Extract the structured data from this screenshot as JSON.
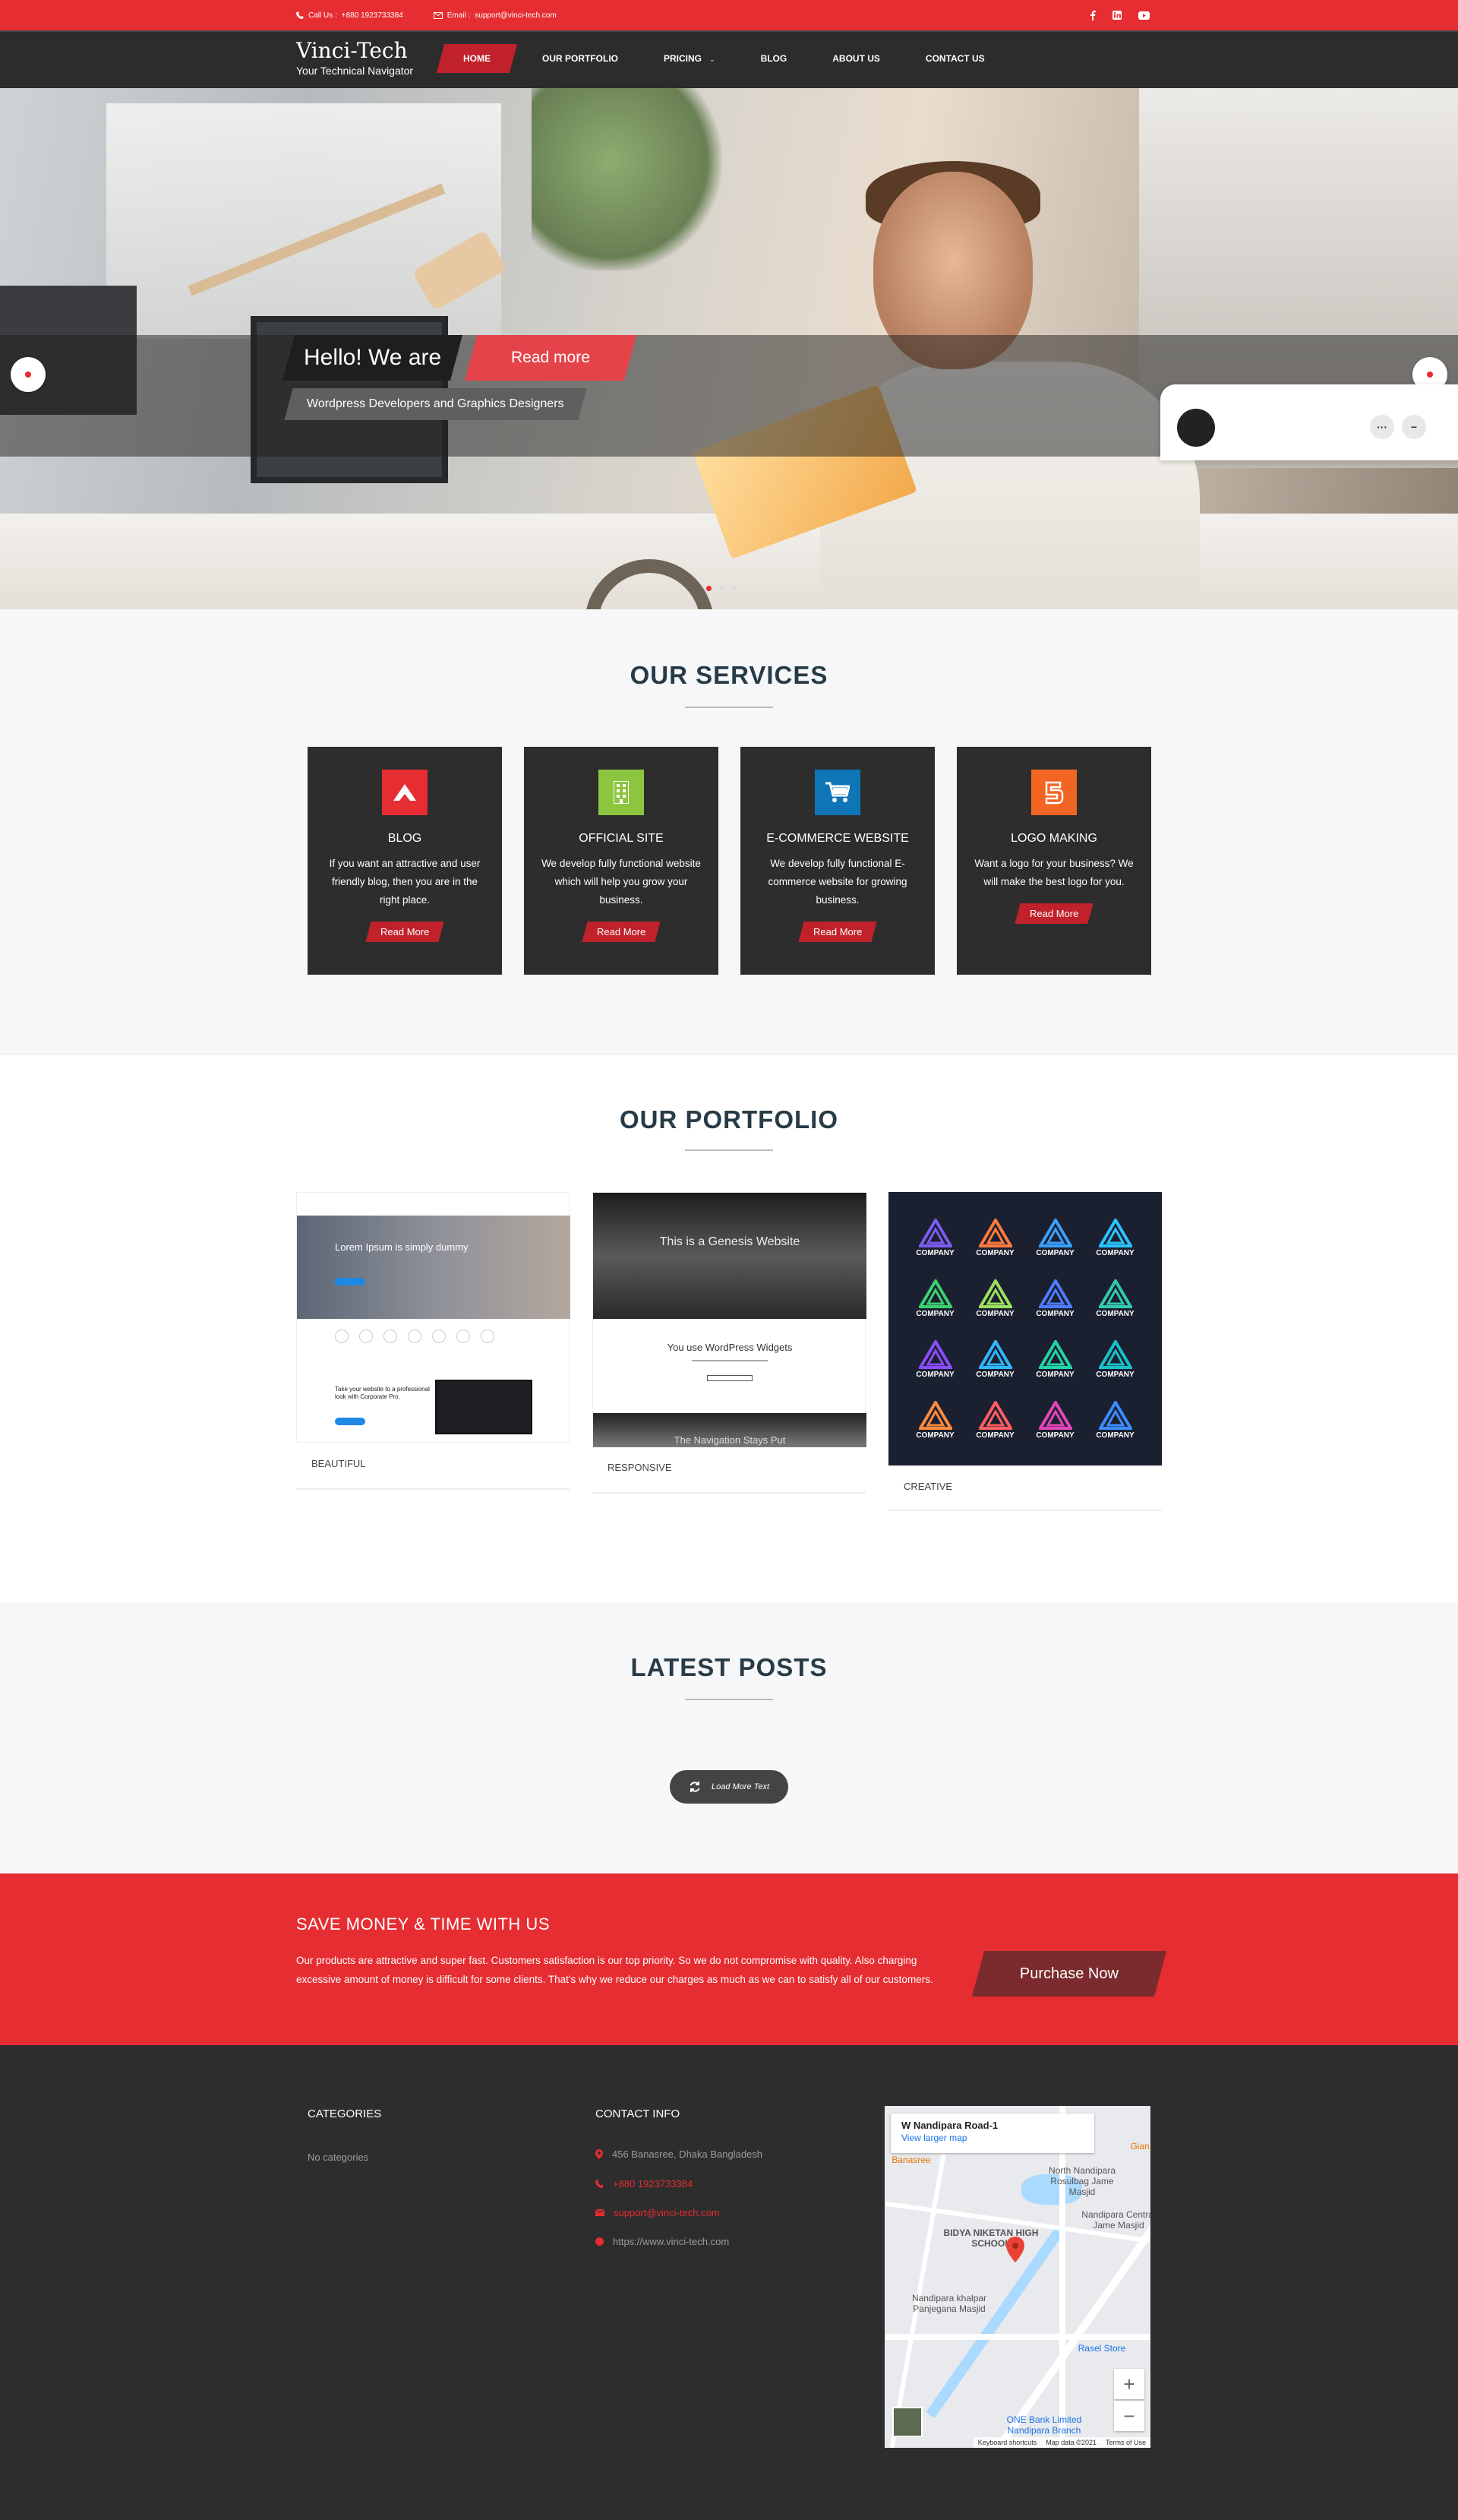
{
  "topbar": {
    "call_label": "Call Us :",
    "phone": "+880 1923733384",
    "email_label": "Email :",
    "email": "support@vinci-tech.com",
    "social": [
      "facebook-icon",
      "linkedin-icon",
      "youtube-icon"
    ]
  },
  "brand": {
    "title": "Vinci-Tech",
    "tagline": "Your Technical Navigator"
  },
  "nav": {
    "items": [
      "HOME",
      "OUR PORTFOLIO",
      "PRICING",
      "BLOG",
      "ABOUT US",
      "CONTACT US"
    ],
    "active": "HOME"
  },
  "hero": {
    "heading": "Hello! We are",
    "button": "Read more",
    "subtitle": "Wordpress Developers and Graphics Designers"
  },
  "services": {
    "title": "OUR SERVICES",
    "cards": [
      {
        "title": "BLOG",
        "text": "If you want an attractive and user friendly blog, then you are in the right place.",
        "button": "Read More",
        "color": "#e52d32",
        "icon": "mountain-icon"
      },
      {
        "title": "OFFICIAL SITE",
        "text": "We develop fully functional website which will help you grow your business.",
        "button": "Read More",
        "color": "#8cc63f",
        "icon": "building-icon"
      },
      {
        "title": "E-COMMERCE WEBSITE",
        "text": "We develop fully functional E-commerce website for growing business.",
        "button": "Read More",
        "color": "#0e75b6",
        "icon": "cart-icon"
      },
      {
        "title": "LOGO MAKING",
        "text": "Want a logo for your business? We will make the best logo for you.",
        "button": "Read More",
        "color": "#f26522",
        "icon": "logo-icon"
      }
    ]
  },
  "portfolio": {
    "title": "OUR PORTFOLIO",
    "items": [
      {
        "label": "BEAUTIFUL",
        "shot_heading": "Lorem Ipsum is simply dummy",
        "shot_text": "Take your website to a professional look with Corporate Pro."
      },
      {
        "label": "RESPONSIVE",
        "shot_heading": "This is a Genesis Website",
        "shot_sub": "You use WordPress Widgets",
        "shot_foot": "The Navigation Stays Put"
      },
      {
        "label": "CREATIVE",
        "logo_word": "COMPANY"
      }
    ]
  },
  "posts": {
    "title": "LATEST POSTS",
    "load_more": "Load More Text"
  },
  "cta": {
    "title": "SAVE MONEY & TIME WITH US",
    "text": "Our products are attractive and super fast. Customers satisfaction is our top priority. So we do not compromise with quality. Also charging excessive amount of money is difficult for some clients. That's why we reduce our charges as much as we can to satisfy all of our customers.",
    "button": "Purchase Now"
  },
  "footer": {
    "categories_title": "CATEGORIES",
    "categories_empty": "No categories",
    "contact_title": "CONTACT INFO",
    "address": "456 Banasree, Dhaka Bangladesh",
    "phone": "+880 1923733384",
    "email": "support@vinci-tech.com",
    "website": "https://www.vinci-tech.com",
    "accent": "#e52d32"
  },
  "map": {
    "place": "W Nandipara Road-1",
    "larger": "View larger map",
    "labels": [
      "North Nandipara Rosulbag Jame Masjid",
      "Nandipara Central Jame Masjid",
      "BIDYA NIKETAN HIGH SCHOOL",
      "Nandipara khalpar Panjegana Masjid",
      "Rasel Store",
      "ONE Bank Limited Nandipara Branch",
      "Banasree",
      "Gian"
    ],
    "footer": [
      "Keyboard shortcuts",
      "Map data ©2021",
      "Terms of Use"
    ],
    "zoom_in": "+",
    "zoom_out": "−"
  }
}
